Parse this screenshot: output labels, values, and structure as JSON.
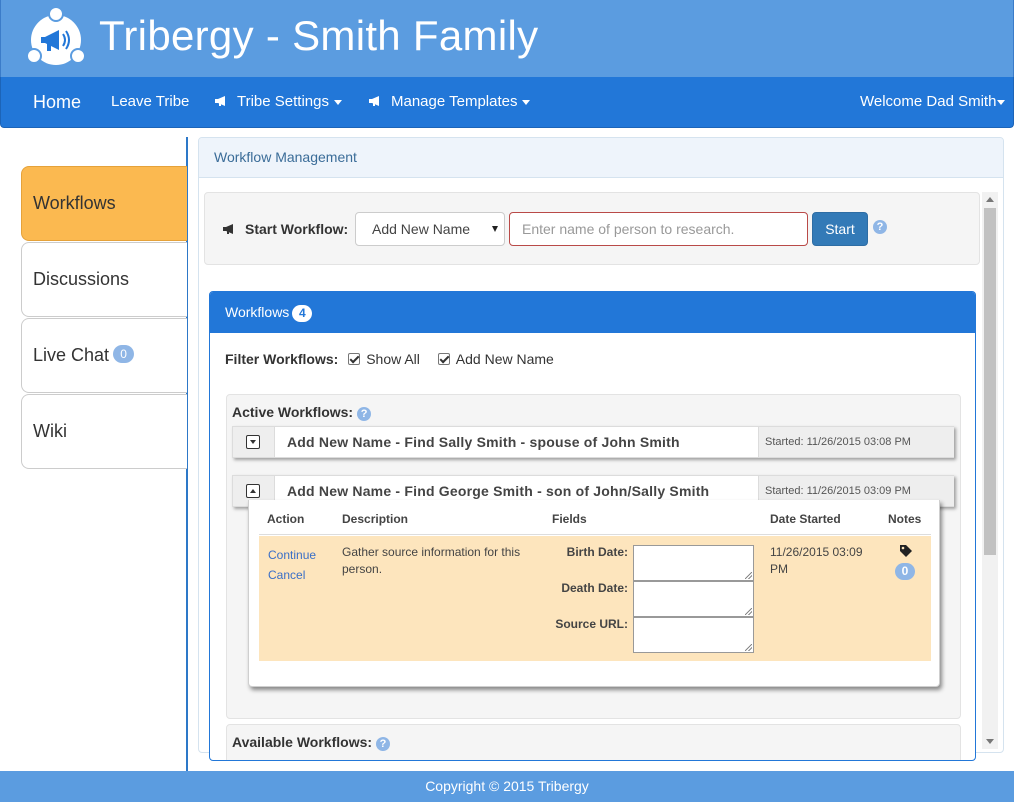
{
  "brand": {
    "title": "Tribergy - Smith Family"
  },
  "nav": {
    "home": "Home",
    "leave": "Leave Tribe",
    "settings": "Tribe Settings",
    "templates": "Manage Templates",
    "welcome": "Welcome Dad Smith"
  },
  "sidebar": {
    "tabs": [
      {
        "label": "Workflows"
      },
      {
        "label": "Discussions"
      },
      {
        "label": "Live Chat",
        "badge": "0"
      },
      {
        "label": "Wiki"
      }
    ]
  },
  "panel": {
    "title": "Workflow Management"
  },
  "start": {
    "label": "Start Workflow:",
    "selected": "Add New Name",
    "placeholder": "Enter name of person to research.",
    "button": "Start",
    "help": "?"
  },
  "workflows": {
    "title": "Workflows",
    "count": "4",
    "filter_label": "Filter Workflows:",
    "filter_options": [
      "Show All",
      "Add New Name"
    ],
    "active_title": "Active Workflows:",
    "available_title": "Available Workflows:",
    "items": [
      {
        "title": "Add New Name - Find Sally Smith - spouse of John Smith",
        "started": "Started: 11/26/2015 03:08 PM"
      },
      {
        "title": "Add New Name - Find George Smith - son of John/Sally Smith",
        "started": "Started: 11/26/2015 03:09 PM"
      }
    ],
    "detail": {
      "headers": {
        "action": "Action",
        "description": "Description",
        "fields": "Fields",
        "date": "Date Started",
        "notes": "Notes"
      },
      "actions": [
        "Continue",
        "Cancel"
      ],
      "description": "Gather source information for this person.",
      "fields": [
        "Birth Date:",
        "Death Date:",
        "Source URL:"
      ],
      "date": "11/26/2015 03:09 PM",
      "notes_count": "0"
    }
  },
  "footer": {
    "text": "Copyright © 2015 Tribergy"
  },
  "colors": {
    "brand": "#5b9ce0",
    "nav": "#2277d8",
    "active_tab": "#fbb950",
    "detail_row": "#fde5bd"
  }
}
